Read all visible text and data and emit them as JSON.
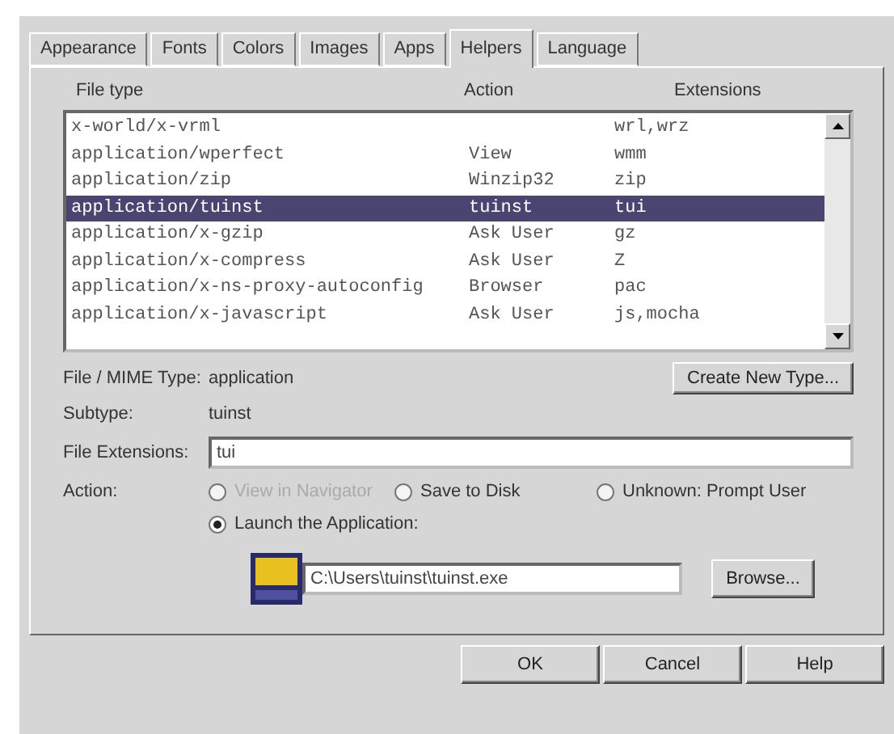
{
  "tabs": [
    {
      "label": "Appearance",
      "selected": false
    },
    {
      "label": "Fonts",
      "selected": false
    },
    {
      "label": "Colors",
      "selected": false
    },
    {
      "label": "Images",
      "selected": false
    },
    {
      "label": "Apps",
      "selected": false
    },
    {
      "label": "Helpers",
      "selected": true
    },
    {
      "label": "Language",
      "selected": false
    }
  ],
  "table": {
    "columns": [
      "File type",
      "Action",
      "Extensions"
    ],
    "rows": [
      {
        "type": "x-world/x-vrml",
        "action": "",
        "ext": "wrl,wrz",
        "selected": false
      },
      {
        "type": "application/wperfect",
        "action": "View",
        "ext": "wmm",
        "selected": false
      },
      {
        "type": "application/zip",
        "action": "Winzip32",
        "ext": "zip",
        "selected": false
      },
      {
        "type": "application/tuinst",
        "action": "tuinst",
        "ext": "tui",
        "selected": true
      },
      {
        "type": "application/x-gzip",
        "action": "Ask User",
        "ext": "gz",
        "selected": false
      },
      {
        "type": "application/x-compress",
        "action": "Ask User",
        "ext": "Z",
        "selected": false
      },
      {
        "type": "application/x-ns-proxy-autoconfig",
        "action": "Browser",
        "ext": "pac",
        "selected": false
      },
      {
        "type": "application/x-javascript",
        "action": "Ask User",
        "ext": "js,mocha",
        "selected": false
      }
    ]
  },
  "details": {
    "mime_label": "File / MIME Type:",
    "mime_value": "application",
    "create_button": "Create New Type...",
    "subtype_label": "Subtype:",
    "subtype_value": "tuinst",
    "ext_label": "File Extensions:",
    "ext_value": "tui",
    "action_label": "Action:",
    "actions": [
      {
        "label": "View in Navigator",
        "selected": false,
        "disabled": true
      },
      {
        "label": "Save to Disk",
        "selected": false,
        "disabled": false
      },
      {
        "label": "Unknown: Prompt User",
        "selected": false,
        "disabled": false
      },
      {
        "label": "Launch the Application:",
        "selected": true,
        "disabled": false
      }
    ],
    "app_path": "C:\\Users\\tuinst\\tuinst.exe",
    "browse_button": "Browse..."
  },
  "buttons": [
    "OK",
    "Cancel",
    "Help"
  ]
}
